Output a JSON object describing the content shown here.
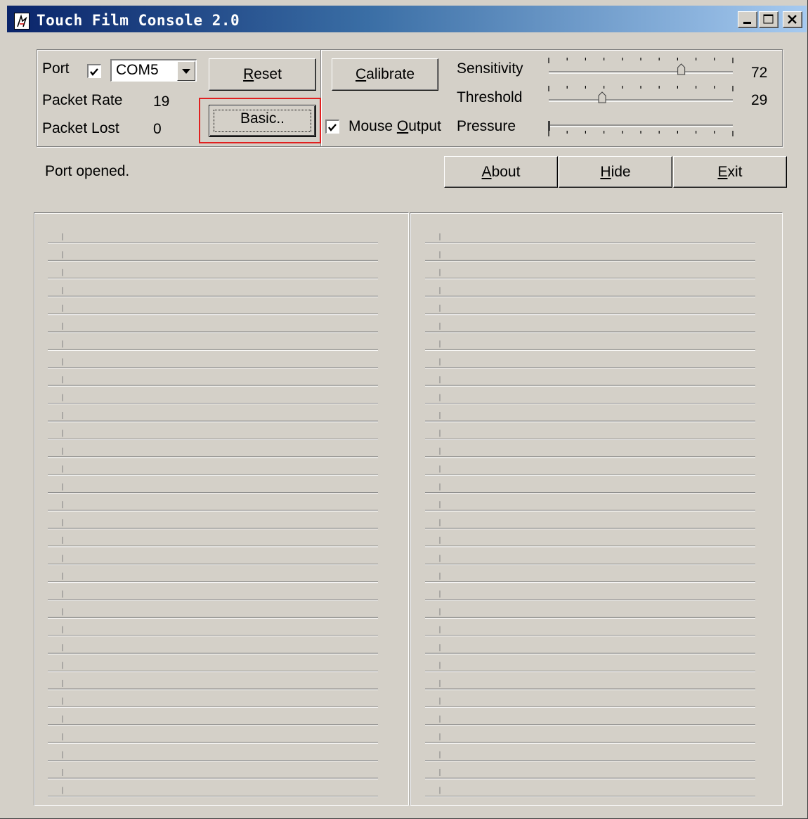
{
  "window": {
    "title": "Touch Film Console 2.0"
  },
  "port": {
    "label": "Port",
    "enabled": true,
    "selected": "COM5"
  },
  "stats": {
    "packet_rate_label": "Packet Rate",
    "packet_rate_value": "19",
    "packet_lost_label": "Packet Lost",
    "packet_lost_value": "0"
  },
  "buttons": {
    "reset": {
      "pre": "",
      "key": "R",
      "post": "eset"
    },
    "basic": "Basic..",
    "calibrate": {
      "pre": "",
      "key": "C",
      "post": "alibrate"
    },
    "about": {
      "pre": "",
      "key": "A",
      "post": "bout"
    },
    "hide": {
      "pre": "",
      "key": "H",
      "post": "ide"
    },
    "exit": {
      "pre": "",
      "key": "E",
      "post": "xit"
    }
  },
  "mouse_output": {
    "pre": "Mouse ",
    "key": "O",
    "post": "utput",
    "checked": true
  },
  "sliders": {
    "sensitivity": {
      "label": "Sensitivity",
      "value": 72,
      "display": "72"
    },
    "threshold": {
      "label": "Threshold",
      "value": 29,
      "display": "29"
    },
    "pressure": {
      "label": "Pressure",
      "value": 0
    }
  },
  "status": {
    "message": "Port opened."
  },
  "colors": {
    "face": "#d4d0c8",
    "highlight_box": "#e02020",
    "title_gradient_start": "#0a246a",
    "title_gradient_end": "#a6caf0"
  }
}
